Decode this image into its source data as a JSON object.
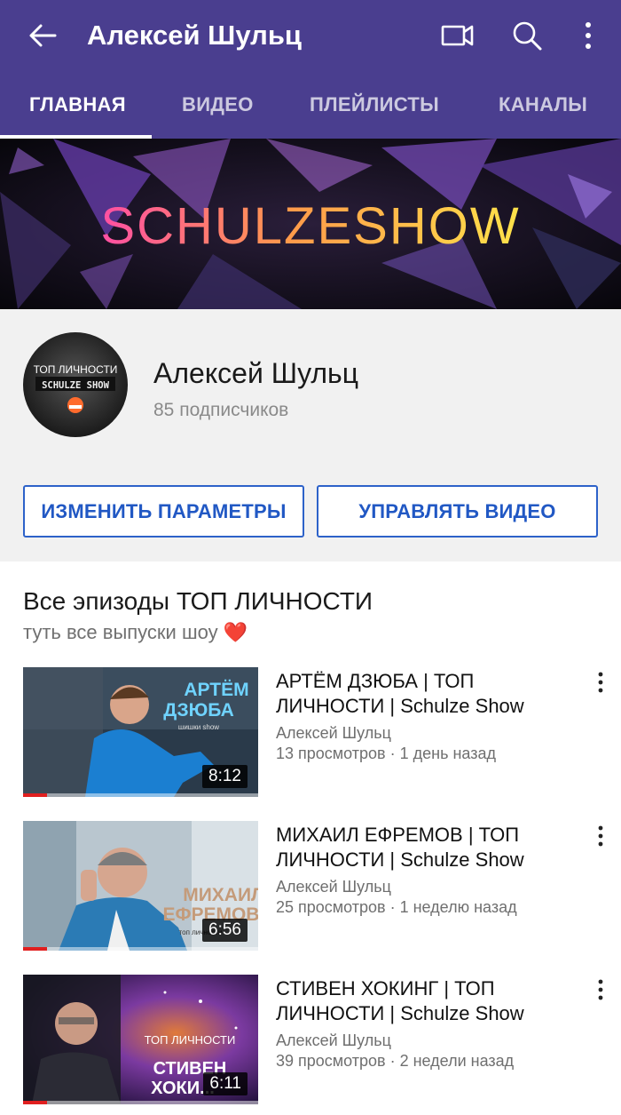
{
  "header": {
    "title": "Алексей Шульц",
    "icons": [
      "back-arrow-icon",
      "video-camera-icon",
      "search-icon",
      "more-vert-icon"
    ],
    "background": "#4a3e8f"
  },
  "tabs": [
    {
      "label": "ГЛАВНАЯ",
      "active": true
    },
    {
      "label": "ВИДЕО",
      "active": false
    },
    {
      "label": "ПЛЕЙЛИСТЫ",
      "active": false
    },
    {
      "label": "КАНАЛЫ",
      "active": false
    }
  ],
  "banner": {
    "text": "SCHULZESHOW"
  },
  "channel": {
    "name": "Алексей Шульц",
    "subscribers": "85 подписчиков",
    "avatar_text": [
      "ТОП ЛИЧНОСТИ",
      "SCHULZE SHOW"
    ],
    "edit_button": "ИЗМЕНИТЬ ПАРАМЕТРЫ",
    "manage_button": "УПРАВЛЯТЬ ВИДЕО",
    "accent": "#2158c4"
  },
  "section": {
    "title": "Все эпизоды ТОП ЛИЧНОСТИ",
    "subtitle": "туть все выпуски шоу ❤️"
  },
  "videos": [
    {
      "title": "АРТЁМ ДЗЮБА | ТОП ЛИЧНОСТИ | Schulze Show",
      "channel": "Алексей Шульц",
      "meta": "13 просмотров · 1 день назад",
      "duration": "8:12",
      "thumb_text": [
        "АРТЁМ",
        "ДЗЮБА",
        "шишки show"
      ],
      "watched_fraction": 0.1
    },
    {
      "title": "МИХАИЛ ЕФРЕМОВ | ТОП ЛИЧНОСТИ | Schulze Show",
      "channel": "Алексей Шульц",
      "meta": "25 просмотров · 1 неделю назад",
      "duration": "6:56",
      "thumb_text": [
        "МИХАИЛ",
        "ЕФРЕМОВ",
        "топ личности"
      ],
      "watched_fraction": 0.1
    },
    {
      "title": "СТИВЕН ХОКИНГ | ТОП ЛИЧНОСТИ | Schulze Show",
      "channel": "Алексей Шульц",
      "meta": "39 просмотров · 2 недели назад",
      "duration": "6:11",
      "thumb_text": [
        "ТОП ЛИЧНОСТИ",
        "СТИВЕН",
        "ХОКИ..."
      ],
      "watched_fraction": 0.1
    }
  ]
}
